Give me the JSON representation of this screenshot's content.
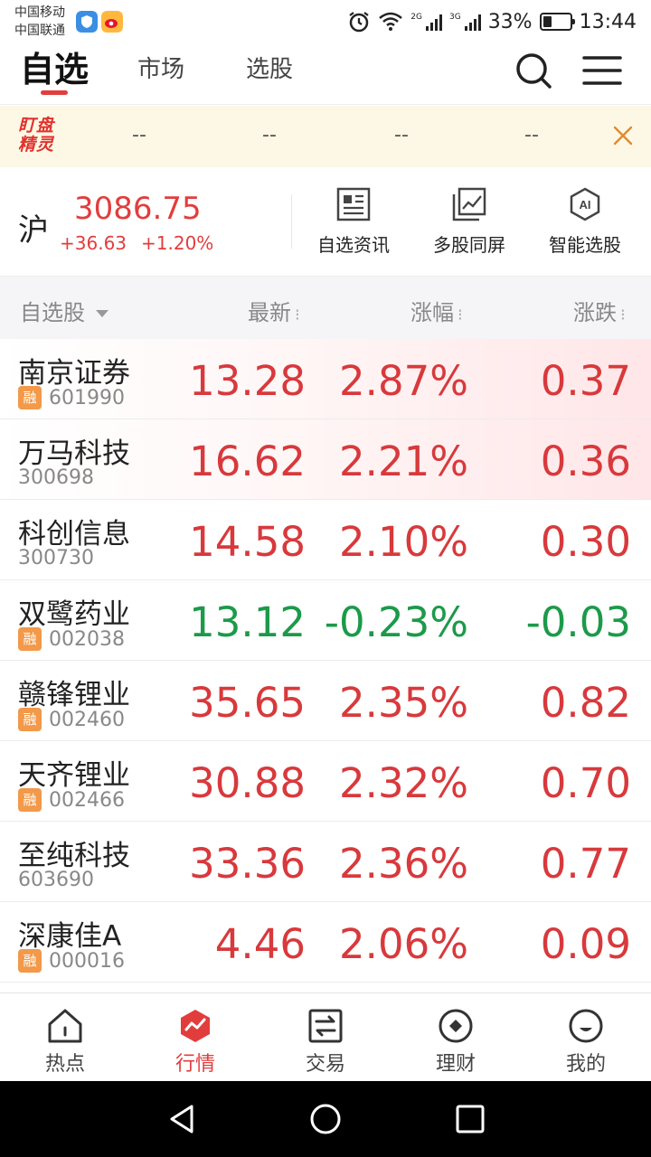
{
  "status_bar": {
    "carrier_1": "中国移动",
    "carrier_2": "中国联通",
    "net_1": "2G",
    "net_2": "3G",
    "battery": "33%",
    "battery_level": 0.33,
    "time": "13:44"
  },
  "header": {
    "tabs": [
      {
        "label": "自选",
        "active": true
      },
      {
        "label": "市场",
        "active": false
      },
      {
        "label": "选股",
        "active": false
      }
    ]
  },
  "banner": {
    "logo": "盯盘精灵",
    "slots": [
      "--",
      "--",
      "--",
      "--"
    ]
  },
  "index": {
    "name": "沪",
    "value": "3086.75",
    "change": "+36.63",
    "change_pct": "+1.20%",
    "actions": [
      {
        "label": "自选资讯",
        "icon": "news-icon"
      },
      {
        "label": "多股同屏",
        "icon": "multi-chart-icon"
      },
      {
        "label": "智能选股",
        "icon": "ai-icon"
      }
    ]
  },
  "list_header": {
    "name": "自选股",
    "price": "最新",
    "pct": "涨幅",
    "change": "涨跌",
    "sort_mark": "⁝"
  },
  "stocks": [
    {
      "name": "南京证券",
      "code": "601990",
      "rong": true,
      "price": "13.28",
      "pct": "2.87%",
      "change": "0.37",
      "dir": "up",
      "hl": true
    },
    {
      "name": "万马科技",
      "code": "300698",
      "rong": false,
      "price": "16.62",
      "pct": "2.21%",
      "change": "0.36",
      "dir": "up",
      "hl": true
    },
    {
      "name": "科创信息",
      "code": "300730",
      "rong": false,
      "price": "14.58",
      "pct": "2.10%",
      "change": "0.30",
      "dir": "up",
      "hl": false
    },
    {
      "name": "双鹭药业",
      "code": "002038",
      "rong": true,
      "price": "13.12",
      "pct": "-0.23%",
      "change": "-0.03",
      "dir": "down",
      "hl": false
    },
    {
      "name": "赣锋锂业",
      "code": "002460",
      "rong": true,
      "price": "35.65",
      "pct": "2.35%",
      "change": "0.82",
      "dir": "up",
      "hl": false
    },
    {
      "name": "天齐锂业",
      "code": "002466",
      "rong": true,
      "price": "30.88",
      "pct": "2.32%",
      "change": "0.70",
      "dir": "up",
      "hl": false
    },
    {
      "name": "至纯科技",
      "code": "603690",
      "rong": false,
      "price": "33.36",
      "pct": "2.36%",
      "change": "0.77",
      "dir": "up",
      "hl": false
    },
    {
      "name": "深康佳A",
      "code": "000016",
      "rong": true,
      "price": "4.46",
      "pct": "2.06%",
      "change": "0.09",
      "dir": "up",
      "hl": false
    }
  ],
  "rong_label": "融",
  "bottom_nav": [
    {
      "label": "热点",
      "icon": "home-icon",
      "active": false
    },
    {
      "label": "行情",
      "icon": "market-icon",
      "active": true
    },
    {
      "label": "交易",
      "icon": "trade-icon",
      "active": false
    },
    {
      "label": "理财",
      "icon": "finance-icon",
      "active": false
    },
    {
      "label": "我的",
      "icon": "profile-icon",
      "active": false
    }
  ],
  "colors": {
    "up": "#d8393c",
    "down": "#1c9a4a",
    "accent": "#e23d3d",
    "banner_bg": "#fdf8e6"
  }
}
